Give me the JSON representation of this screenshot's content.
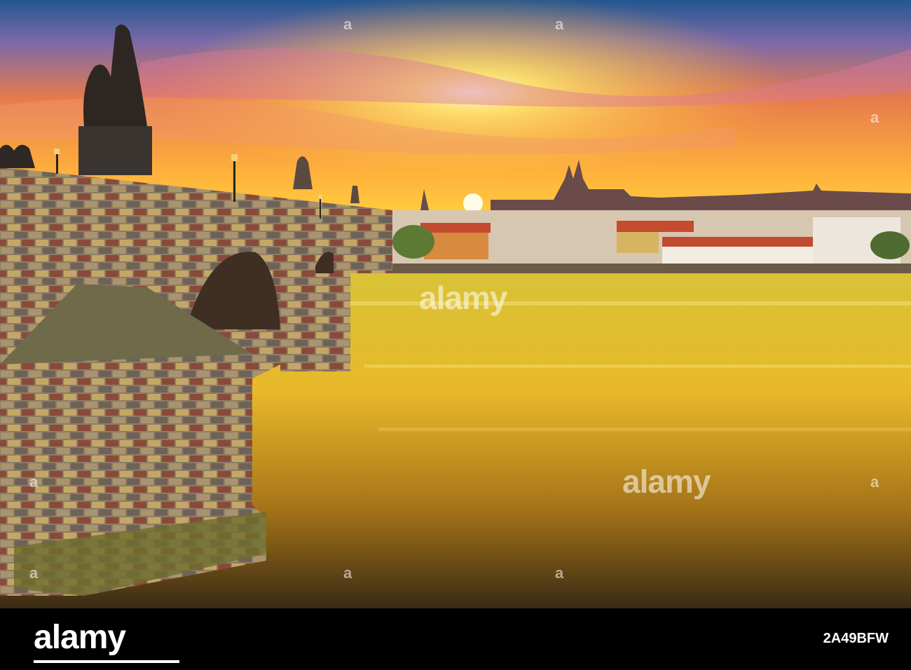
{
  "watermark": {
    "text": "alamy",
    "mark": "a"
  },
  "footer": {
    "brand": "alamy",
    "stock_id": "2A49BFW"
  },
  "colors": {
    "sky_top": "#2f5f9a",
    "sky_glow": "#ffcf3a",
    "water": "#e2b82a",
    "stone": "#7b6a5a",
    "footer_bg": "#000000"
  }
}
